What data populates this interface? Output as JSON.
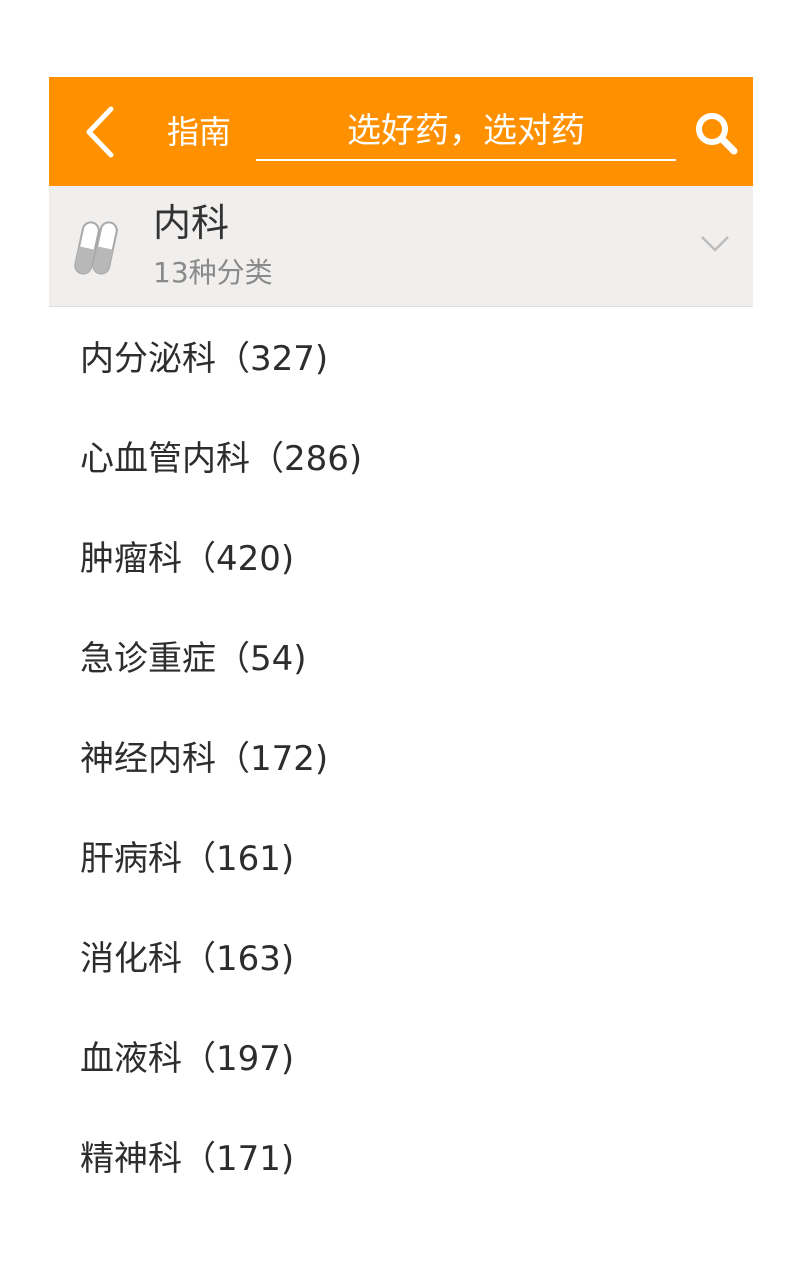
{
  "header": {
    "back_icon": "chevron-left-icon",
    "title": "指南",
    "search_value": "选好药，选对药",
    "search_icon": "search-icon",
    "background_color": "#ff9100"
  },
  "category": {
    "icon": "pill-capsule-icon",
    "title": "内科",
    "subtitle": "13种分类",
    "expand_icon": "chevron-down-icon"
  },
  "list": [
    {
      "label": "内分泌科（327)"
    },
    {
      "label": "心血管内科（286)"
    },
    {
      "label": "肿瘤科（420)"
    },
    {
      "label": "急诊重症（54)"
    },
    {
      "label": "神经内科（172)"
    },
    {
      "label": "肝病科（161)"
    },
    {
      "label": "消化科（163)"
    },
    {
      "label": "血液科（197)"
    },
    {
      "label": "精神科（171)"
    }
  ]
}
